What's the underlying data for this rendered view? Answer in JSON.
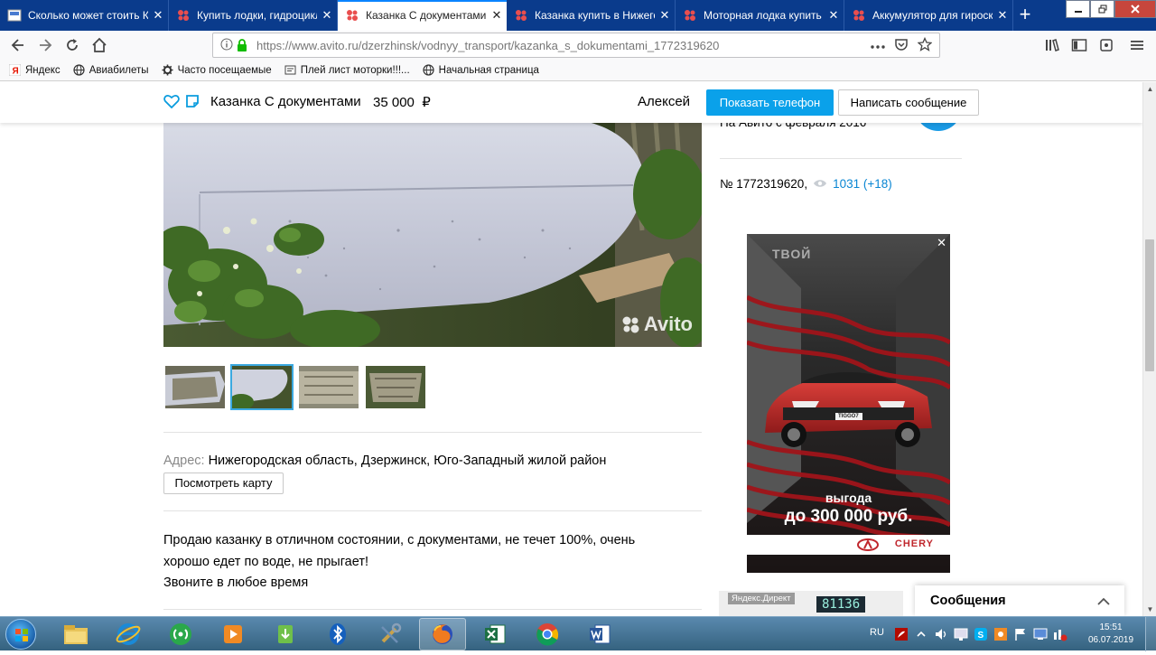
{
  "browser": {
    "tabs": [
      {
        "title": "Сколько может стоить Ка",
        "favicon": "site-icon",
        "active": false
      },
      {
        "title": "Купить лодки, гидроцикл",
        "favicon": "avito-icon",
        "active": false
      },
      {
        "title": "Казанка С документами в",
        "favicon": "avito-icon",
        "active": true
      },
      {
        "title": "Казанка купить в Нижего",
        "favicon": "avito-icon",
        "active": false
      },
      {
        "title": "Моторная лодка купить в",
        "favicon": "avito-icon",
        "active": false
      },
      {
        "title": "Аккумулятор для гироск",
        "favicon": "avito-icon",
        "active": false
      }
    ],
    "close_glyph": "✕",
    "newtab_glyph": "+",
    "url": {
      "prefix": "https://www.",
      "host": "avito.ru",
      "path": "/dzerzhinsk/vodnyy_transport/kazanka_s_dokumentami_1772319620"
    },
    "bookmarks": [
      {
        "label": "Яндекс",
        "icon": "yandex-icon"
      },
      {
        "label": "Авиабилеты",
        "icon": "globe-icon"
      },
      {
        "label": "Часто посещаемые",
        "icon": "gear-icon"
      },
      {
        "label": "Плей лист моторки!!!...",
        "icon": "bookmark-icon"
      },
      {
        "label": "Начальная страница",
        "icon": "globe-icon"
      }
    ]
  },
  "page": {
    "header": {
      "title": "Казанка С документами",
      "price": "35 000",
      "currency": "₽",
      "seller": "Алексей",
      "phone_button": "Показать телефон",
      "message_button": "Написать сообщение"
    },
    "watermark": "Avito",
    "seller_since": "На Авито с февраля 2016",
    "ad_number": "№ 1772319620,",
    "views": "1031 (+18)",
    "address": {
      "label": "Адрес:",
      "value": "Нижегородская область, Дзержинск, Юго-Западный жилой район",
      "map_button": "Посмотреть карту"
    },
    "description": [
      "Продаю казанку в отличном состоянии, с документами, не течет 100%, очень",
      "хорошо едет по воде, не прыгает!",
      "Звоните в любое время"
    ],
    "ad": {
      "close": "✕",
      "top_word": "ТВОЙ",
      "line1": "выгода",
      "line2": "до 300 000 руб.",
      "brand": "CHERY",
      "plate": "TIGGO7"
    },
    "ad2": {
      "tag": "Яндекс.Директ",
      "number": "81136"
    },
    "messages": {
      "title": "Сообщения"
    }
  },
  "taskbar": {
    "lang": "RU",
    "time": "15:51",
    "date": "06.07.2019"
  },
  "colors": {
    "tabstrip": "#0a3b8c",
    "phone_button": "#0aa1ea",
    "views_link": "#0a86d3",
    "avito_red": "#e94e4e"
  }
}
